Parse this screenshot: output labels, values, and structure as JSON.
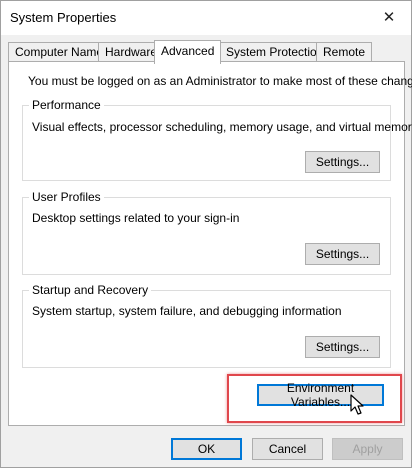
{
  "window": {
    "title": "System Properties",
    "close_glyph": "✕"
  },
  "tabs": [
    {
      "label": "Computer Name",
      "active": false
    },
    {
      "label": "Hardware",
      "active": false
    },
    {
      "label": "Advanced",
      "active": true
    },
    {
      "label": "System Protection",
      "active": false
    },
    {
      "label": "Remote",
      "active": false
    }
  ],
  "advanced": {
    "admin_note": "You must be logged on as an Administrator to make most of these changes.",
    "performance": {
      "label": "Performance",
      "description": "Visual effects, processor scheduling, memory usage, and virtual memory",
      "button": "Settings..."
    },
    "user_profiles": {
      "label": "User Profiles",
      "description": "Desktop settings related to your sign-in",
      "button": "Settings..."
    },
    "startup_recovery": {
      "label": "Startup and Recovery",
      "description": "System startup, system failure, and debugging information",
      "button": "Settings..."
    },
    "env_button": "Environment Variables..."
  },
  "footer": {
    "ok": "OK",
    "cancel": "Cancel",
    "apply": "Apply"
  },
  "colors": {
    "highlight": "#e0474c",
    "focus": "#0078d7",
    "window_bg": "#f0f0f0"
  }
}
